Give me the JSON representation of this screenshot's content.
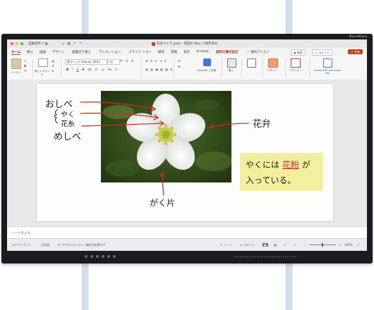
{
  "window": {
    "autosave_label": "自動保存",
    "document_title": "花のつくり.pptx - 前回の Mac に保存済み",
    "toolbar_icons": [
      "home-icon",
      "save-icon",
      "undo-icon",
      "redo-icon",
      "more-icon"
    ]
  },
  "device": {
    "brand": "ShareBoard"
  },
  "ribbon_tabs": [
    {
      "label": "ホーム",
      "active": true
    },
    {
      "label": "挿入"
    },
    {
      "label": "描画"
    },
    {
      "label": "デザイン"
    },
    {
      "label": "画面切り替え"
    },
    {
      "label": "アニメーション"
    },
    {
      "label": "スライド ショー"
    },
    {
      "label": "録音"
    },
    {
      "label": "校閲"
    },
    {
      "label": "表示"
    },
    {
      "label": "Acrobat"
    },
    {
      "label": "図形の書式設定",
      "accent": true
    },
    {
      "label": "操作アシスト"
    }
  ],
  "ribbon_buttons": {
    "record": "録音",
    "comment": "コメント",
    "share": "共有"
  },
  "ribbon": {
    "paste": "ペースト",
    "new_slide": "新しいスライド",
    "font_name": "游ゴシック Regular (本文)",
    "font_size": "18",
    "sharekit": "ShareKit に変換",
    "insert": "挿入",
    "design": "デザイン",
    "designer": "デザイナー",
    "create_pdf": "Create PDF and share link",
    "format_buttons": [
      "B",
      "I",
      "U",
      "S",
      "ab",
      "x²",
      "x₂",
      "Aa"
    ]
  },
  "slide": {
    "labels": {
      "oshibe": "おしべ",
      "yaku": "やく",
      "kashi": "花糸",
      "meshibe": "めしべ",
      "kaben": "花弁",
      "gaku": "がく片"
    },
    "callout": {
      "line1_prefix": "やくには",
      "line1_highlight": "花粉",
      "line1_suffix": "が",
      "line2": "入っている。"
    }
  },
  "notes": {
    "placeholder": "ノートを入力"
  },
  "status_bar": {
    "slide_counter": "スライド 1 / 1",
    "language": "日本語",
    "accessibility": "アクセシビリティ: 検討が必要です",
    "notes": "ノート",
    "comments": "コメント",
    "zoom": "100%"
  },
  "colors": {
    "accent": "#c43e1c",
    "ink_red": "#d02a2a",
    "highlight": "#f4ef9f"
  }
}
